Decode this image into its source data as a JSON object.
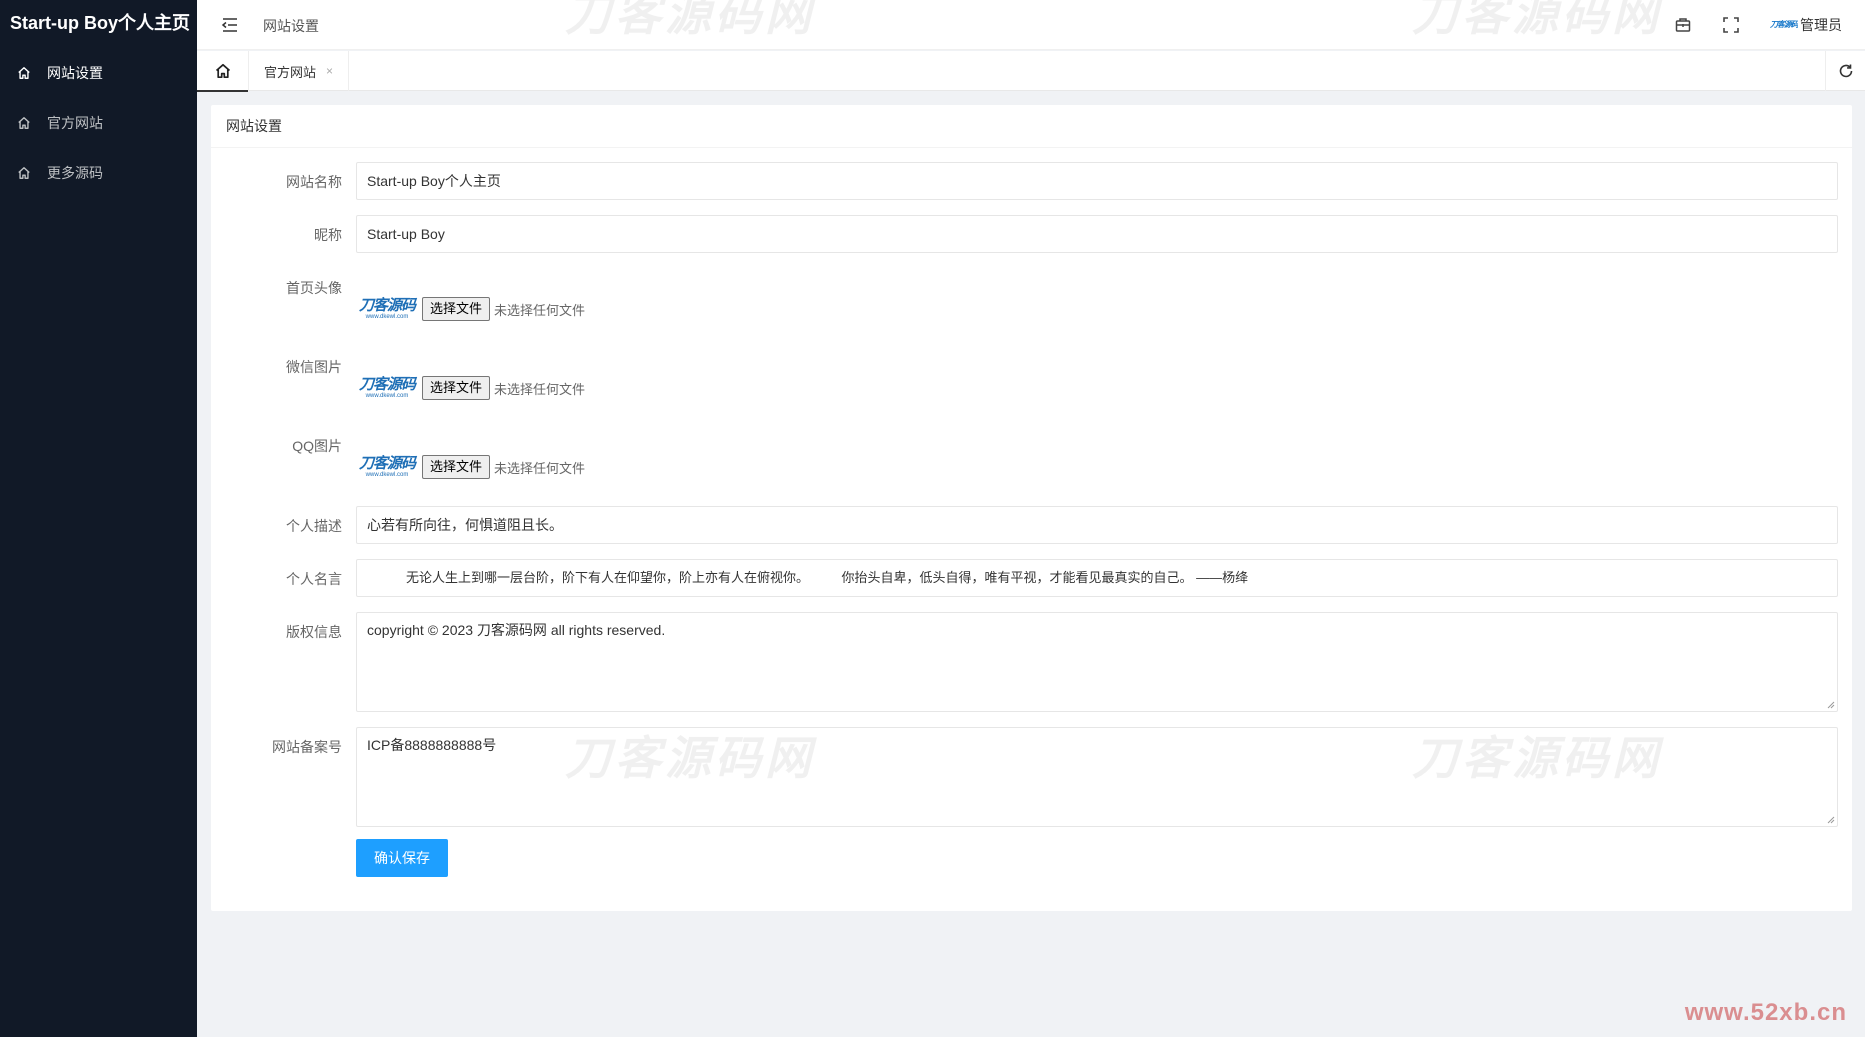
{
  "sidebar": {
    "logo": "Start-up Boy个人主页",
    "items": [
      {
        "label": "网站设置",
        "icon": "home-icon",
        "active": true
      },
      {
        "label": "官方网站",
        "icon": "home-icon",
        "active": false
      },
      {
        "label": "更多源码",
        "icon": "home-icon",
        "active": false
      }
    ]
  },
  "header": {
    "breadcrumb": "网站设置",
    "admin_label": "管理员",
    "admin_logo_text": "刀客源码"
  },
  "tabs": [
    {
      "label": "官方网站",
      "close": "×"
    }
  ],
  "card": {
    "title": "网站设置"
  },
  "form": {
    "site_name": {
      "label": "网站名称",
      "value": "Start-up Boy个人主页"
    },
    "nickname": {
      "label": "昵称",
      "value": "Start-up Boy"
    },
    "avatar": {
      "label": "首页头像",
      "button": "选择文件",
      "status": "未选择任何文件"
    },
    "wechat": {
      "label": "微信图片",
      "button": "选择文件",
      "status": "未选择任何文件"
    },
    "qq": {
      "label": "QQ图片",
      "button": "选择文件",
      "status": "未选择任何文件"
    },
    "description": {
      "label": "个人描述",
      "value": "心若有所向往，何惧道阻且长。"
    },
    "motto": {
      "label": "个人名言",
      "value": "　　　无论人生上到哪一层台阶，阶下有人在仰望你，阶上亦有人在俯视你。　　　你抬头自卑，低头自得，唯有平视，才能看见最真实的自己。 ——杨绛"
    },
    "copyright": {
      "label": "版权信息",
      "value": "copyright © 2023 刀客源码网 all rights reserved."
    },
    "icp": {
      "label": "网站备案号",
      "value": "ICP备8888888888号"
    },
    "submit_label": "确认保存"
  },
  "thumb": {
    "brand": "刀客源码",
    "url": "www.dkewl.com"
  },
  "watermarks": {
    "text": "刀客源码网",
    "corner": "www.52xb.cn"
  },
  "colors": {
    "sidebar_bg": "#111927",
    "primary_button": "#1e9fff",
    "page_bg": "#f0f2f5"
  }
}
